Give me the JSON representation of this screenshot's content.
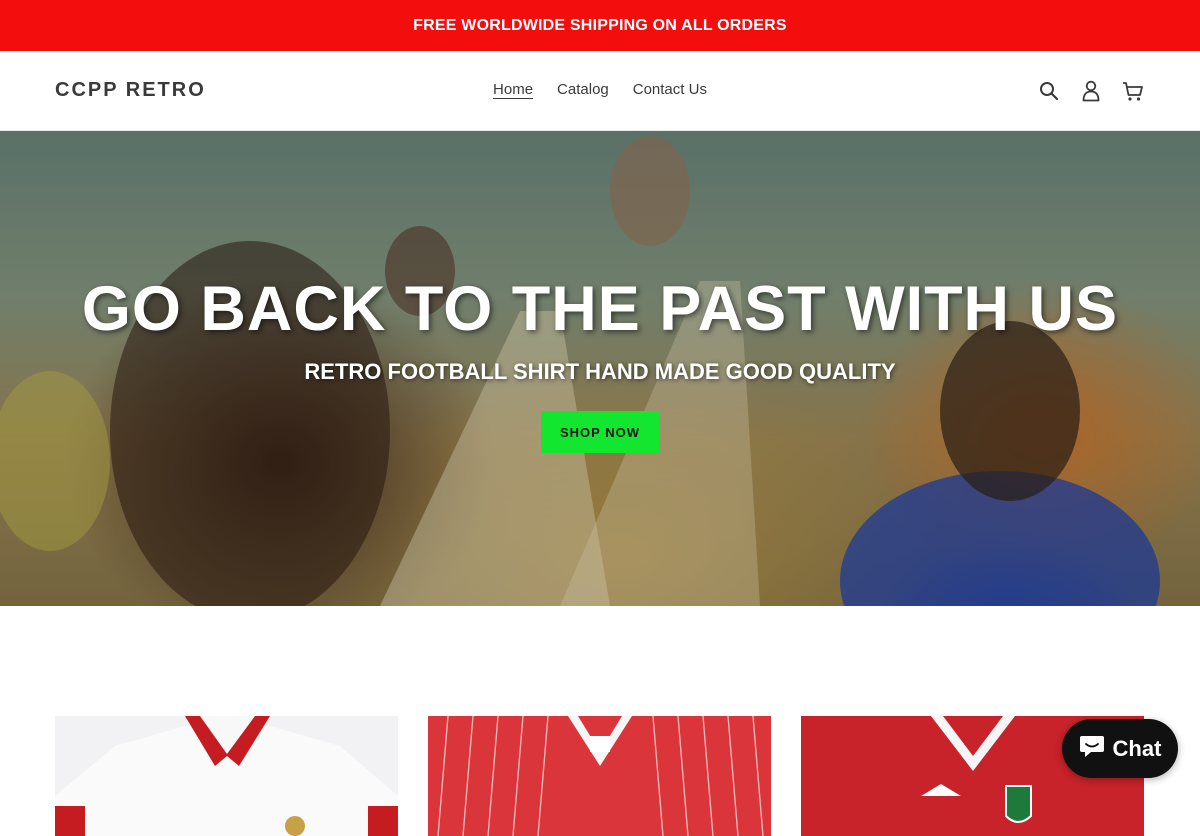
{
  "announcement": {
    "text": "FREE WORLDWIDE SHIPPING ON ALL ORDERS",
    "background": "#f30d0d"
  },
  "header": {
    "logo": "CCPP RETRO",
    "nav": [
      {
        "label": "Home",
        "active": true
      },
      {
        "label": "Catalog",
        "active": false
      },
      {
        "label": "Contact Us",
        "active": false
      }
    ],
    "icons": [
      "search-icon",
      "account-icon",
      "cart-icon"
    ]
  },
  "hero": {
    "title": "GO BACK TO THE PAST WITH US",
    "subtitle": "RETRO FOOTBALL SHIRT HAND MADE GOOD QUALITY",
    "button_label": "SHOP NOW",
    "button_color": "#13e62f"
  },
  "products": [
    {
      "image": "white-red-collar-shirt"
    },
    {
      "image": "red-pinstripe-shirt"
    },
    {
      "image": "red-white-v-neck-shirt"
    }
  ],
  "chat": {
    "label": "Chat",
    "icon": "chat-bubble-icon"
  }
}
